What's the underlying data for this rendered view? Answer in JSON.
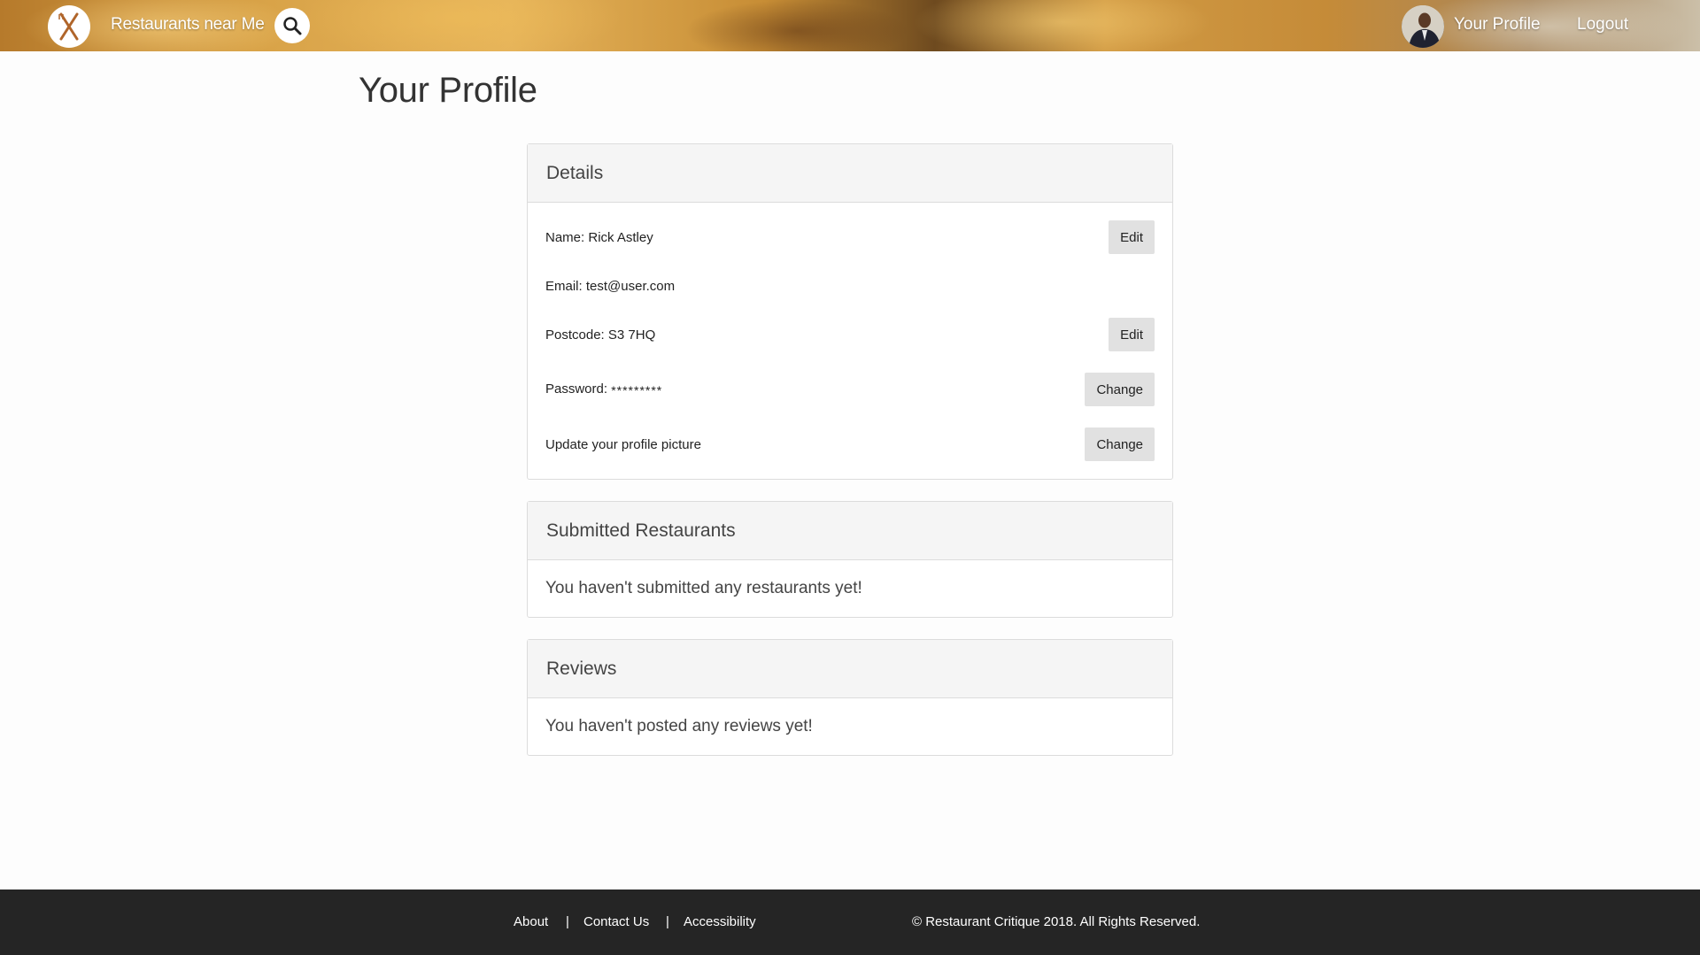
{
  "navbar": {
    "title": "Restaurants near Me",
    "profile_label": "Your Profile",
    "logout_label": "Logout",
    "logo_icon": "fork-knife-icon",
    "search_icon": "search-icon"
  },
  "page": {
    "title": "Your Profile"
  },
  "details": {
    "heading": "Details",
    "name_label": "Name:",
    "name_value": "Rick Astley",
    "email_label": "Email:",
    "email_value": "test@user.com",
    "postcode_label": "Postcode:",
    "postcode_value": "S3 7HQ",
    "password_label": "Password:",
    "password_value": "*********",
    "picture_label": "Update your profile picture",
    "edit_label": "Edit",
    "change_label": "Change"
  },
  "submitted": {
    "heading": "Submitted Restaurants",
    "empty_message": "You haven't submitted any restaurants yet!"
  },
  "reviews": {
    "heading": "Reviews",
    "empty_message": "You haven't posted any reviews yet!"
  },
  "footer": {
    "about": "About",
    "contact": "Contact Us",
    "accessibility": "Accessibility",
    "separator": "|",
    "copyright": "© Restaurant Critique 2018. All Rights Reserved."
  },
  "colors": {
    "footer_bg": "#252525",
    "panel_heading_bg": "#f5f5f5",
    "button_bg": "#e1e1e1"
  }
}
